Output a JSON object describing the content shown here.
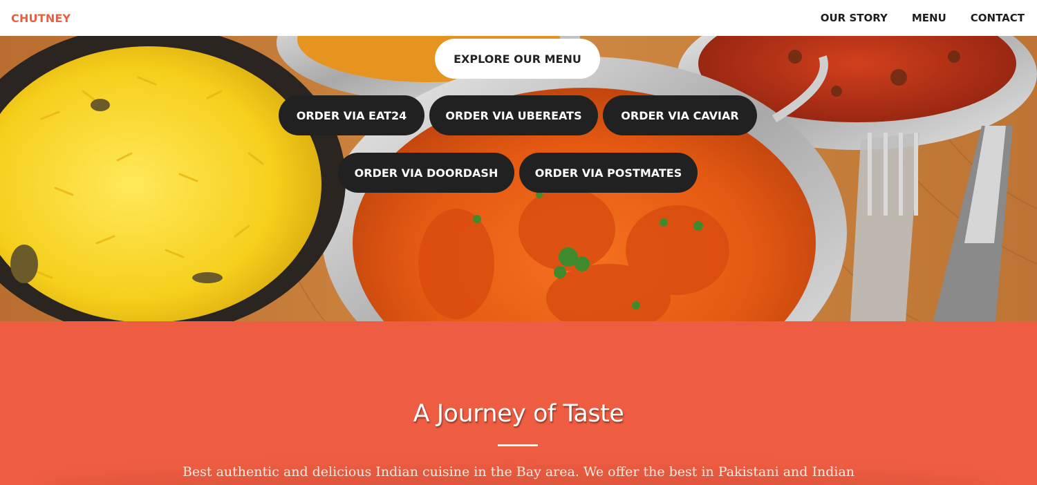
{
  "navbar": {
    "brand": "CHUTNEY",
    "links": [
      {
        "label": "OUR STORY"
      },
      {
        "label": "MENU"
      },
      {
        "label": "CONTACT"
      }
    ]
  },
  "hero": {
    "explore_label": "EXPLORE OUR MENU",
    "order_buttons": [
      {
        "label": "ORDER VIA EAT24"
      },
      {
        "label": "ORDER VIA UBEREATS"
      },
      {
        "label": "ORDER VIA CAVIAR"
      },
      {
        "label": "ORDER VIA DOORDASH"
      },
      {
        "label": "ORDER VIA POSTMATES"
      }
    ]
  },
  "about": {
    "title": "A Journey of Taste",
    "text": "Best authentic and delicious Indian cuisine in the Bay area. We offer the best in Pakistani and Indian"
  },
  "colors": {
    "brand": "#ee5d3f",
    "section_bg": "#ee5d42",
    "button_dark": "#212121",
    "button_light": "#ffffff"
  }
}
